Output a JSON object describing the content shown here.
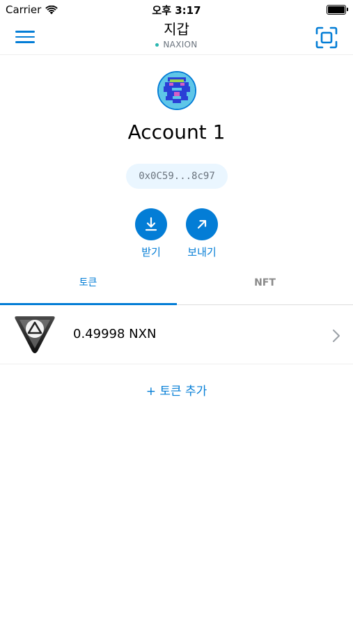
{
  "status_bar": {
    "carrier": "Carrier",
    "time": "오후 3:17"
  },
  "header": {
    "title": "지갑",
    "network": "NAXION",
    "network_dot_color": "#29b6af",
    "menu_icon": "hamburger-menu-icon",
    "scan_icon": "qr-scan-icon"
  },
  "account": {
    "name": "Account 1",
    "address": "0x0C59...8c97"
  },
  "actions": {
    "receive_label": "받기",
    "send_label": "보내기"
  },
  "tabs": [
    {
      "label": "토큰",
      "active": true
    },
    {
      "label": "NFT",
      "active": false
    }
  ],
  "tokens": [
    {
      "balance": "0.49998 NXN",
      "icon": "naxion-token-logo"
    }
  ],
  "add_token_label": "+ 토큰 추가",
  "colors": {
    "accent": "#037dd6",
    "pill_bg": "#eaf6ff",
    "muted": "#6a737d"
  }
}
